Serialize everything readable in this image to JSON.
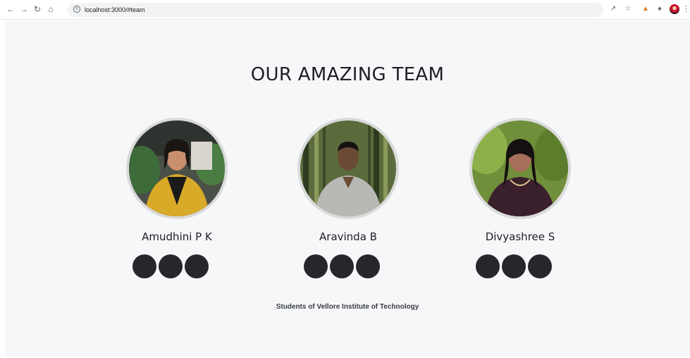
{
  "browser": {
    "url": "localhost:3000/#team",
    "icons": [
      "back-icon",
      "forward-icon",
      "reload-icon",
      "home-icon",
      "info-icon",
      "share-icon",
      "star-icon",
      "metamask-icon",
      "extensions-icon",
      "profile-avatar",
      "menu-icon"
    ]
  },
  "page": {
    "title": "OUR AMAZING TEAM",
    "footer": "Students of Vellore Institute of Technology",
    "members": [
      {
        "name": "Amudhini P K"
      },
      {
        "name": "Aravinda B"
      },
      {
        "name": "Divyashree S"
      }
    ]
  },
  "colors": {
    "background": "#f6f7f9",
    "text": "#1d1f23",
    "social_button": "#25272c",
    "avatar_ring": "#dadada"
  }
}
